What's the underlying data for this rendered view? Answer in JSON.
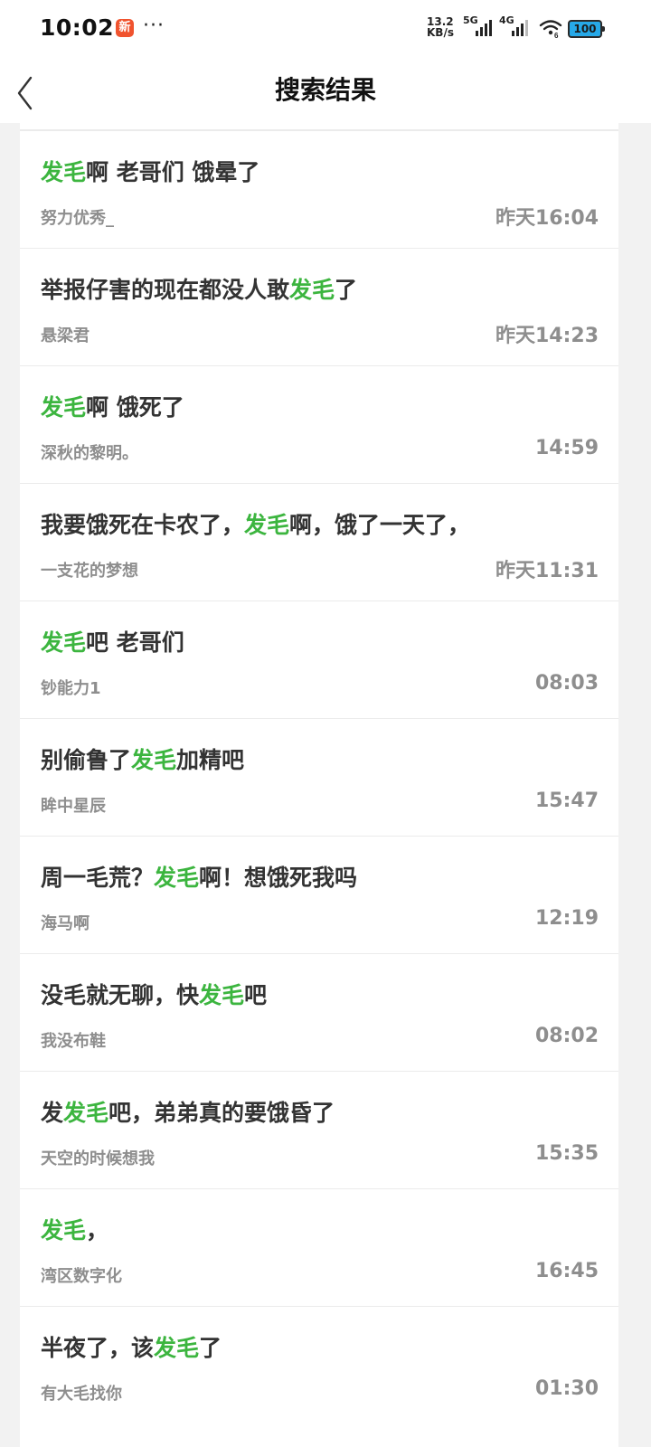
{
  "status_bar": {
    "time": "10:02",
    "app_badge": "新",
    "more": "···",
    "net_speed_value": "13.2",
    "net_speed_unit": "KB/s",
    "signal_1": "5G",
    "signal_2": "4G",
    "wifi_sub": "6",
    "battery": "100"
  },
  "nav": {
    "title": "搜索结果",
    "back_icon": "chevron-left-icon"
  },
  "highlight_color": "#3cb53f",
  "results": [
    {
      "title_before": "",
      "title_keyword": "发毛",
      "title_after": "啊 老哥们 饿晕了",
      "author": "努力优秀_",
      "time": "昨天16:04"
    },
    {
      "title_before": "举报仔害的现在都没人敢",
      "title_keyword": "发毛",
      "title_after": "了",
      "author": "悬梁君",
      "time": "昨天14:23"
    },
    {
      "title_before": "",
      "title_keyword": "发毛",
      "title_after": "啊 饿死了",
      "author": "深秋的黎明。",
      "time": "14:59"
    },
    {
      "title_before": "我要饿死在卡农了，",
      "title_keyword": "发毛",
      "title_after": "啊，饿了一天了，",
      "author": "一支花的梦想",
      "time": "昨天11:31"
    },
    {
      "title_before": "",
      "title_keyword": "发毛",
      "title_after": "吧 老哥们",
      "author": "钞能力1",
      "time": "08:03"
    },
    {
      "title_before": "别偷鲁了",
      "title_keyword": "发毛",
      "title_after": "加精吧",
      "author": "眸中星辰",
      "time": "15:47"
    },
    {
      "title_before": "周一毛荒？",
      "title_keyword": "发毛",
      "title_after": "啊！想饿死我吗",
      "author": "海马啊",
      "time": "12:19"
    },
    {
      "title_before": "没毛就无聊，快",
      "title_keyword": "发毛",
      "title_after": "吧",
      "author": "我没布鞋",
      "time": "08:02"
    },
    {
      "title_before": "发",
      "title_keyword": "发毛",
      "title_after": "吧，弟弟真的要饿昏了",
      "author": "天空的时候想我",
      "time": "15:35"
    },
    {
      "title_before": "",
      "title_keyword": "发毛",
      "title_after": "，",
      "author": "湾区数字化",
      "time": "16:45"
    },
    {
      "title_before": "半夜了，该",
      "title_keyword": "发毛",
      "title_after": "了",
      "author": "有大毛找你",
      "time": "01:30"
    }
  ]
}
